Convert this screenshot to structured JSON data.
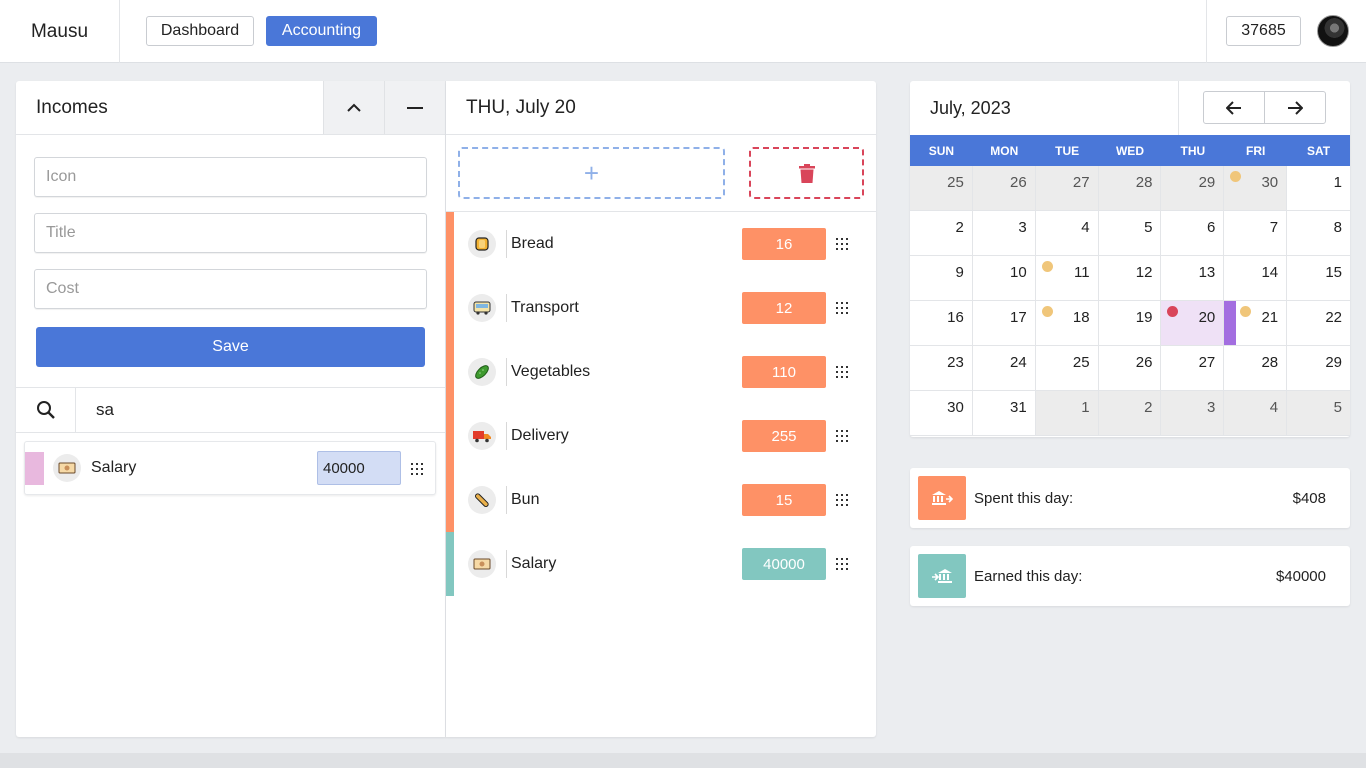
{
  "app": {
    "brand": "Mausu",
    "balance": "37685"
  },
  "nav": {
    "dashboard": "Dashboard",
    "accounting": "Accounting"
  },
  "colors": {
    "accent": "#4a77d8",
    "expense": "#fe9166",
    "income": "#82c7c0",
    "danger": "#d9455a",
    "today": "#efe1f6"
  },
  "incomes": {
    "title": "Incomes",
    "fields": {
      "icon_placeholder": "Icon",
      "title_placeholder": "Title",
      "cost_placeholder": "Cost"
    },
    "save_label": "Save",
    "search_value": "sa",
    "results": [
      {
        "icon": "money-icon",
        "label": "Salary",
        "cost": "40000"
      }
    ]
  },
  "day": {
    "title": "THU, July 20",
    "add_label": "+",
    "entries": [
      {
        "icon": "bread-icon",
        "label": "Bread",
        "value": "16",
        "kind": "expense"
      },
      {
        "icon": "bus-icon",
        "label": "Transport",
        "value": "12",
        "kind": "expense"
      },
      {
        "icon": "cucumber-icon",
        "label": "Vegetables",
        "value": "110",
        "kind": "expense"
      },
      {
        "icon": "truck-icon",
        "label": "Delivery",
        "value": "255",
        "kind": "expense"
      },
      {
        "icon": "baguette-icon",
        "label": "Bun",
        "value": "15",
        "kind": "expense"
      },
      {
        "icon": "money-icon",
        "label": "Salary",
        "value": "40000",
        "kind": "income"
      }
    ]
  },
  "calendar": {
    "title": "July, 2023",
    "weekdays": [
      "SUN",
      "MON",
      "TUE",
      "WED",
      "THU",
      "FRI",
      "SAT"
    ],
    "days": [
      {
        "n": "25",
        "other": true
      },
      {
        "n": "26",
        "other": true
      },
      {
        "n": "27",
        "other": true
      },
      {
        "n": "28",
        "other": true
      },
      {
        "n": "29",
        "other": true
      },
      {
        "n": "30",
        "other": true,
        "dot": "#f0c67a"
      },
      {
        "n": "1"
      },
      {
        "n": "2"
      },
      {
        "n": "3"
      },
      {
        "n": "4"
      },
      {
        "n": "5"
      },
      {
        "n": "6"
      },
      {
        "n": "7"
      },
      {
        "n": "8"
      },
      {
        "n": "9"
      },
      {
        "n": "10"
      },
      {
        "n": "11",
        "dot": "#f0c67a"
      },
      {
        "n": "12"
      },
      {
        "n": "13"
      },
      {
        "n": "14"
      },
      {
        "n": "15"
      },
      {
        "n": "16"
      },
      {
        "n": "17"
      },
      {
        "n": "18",
        "dot": "#f0c67a"
      },
      {
        "n": "19"
      },
      {
        "n": "20",
        "today": true,
        "dot": "#d9455a"
      },
      {
        "n": "21",
        "mark": true,
        "dot": "#f0c67a"
      },
      {
        "n": "22"
      },
      {
        "n": "23"
      },
      {
        "n": "24"
      },
      {
        "n": "25"
      },
      {
        "n": "26"
      },
      {
        "n": "27"
      },
      {
        "n": "28"
      },
      {
        "n": "29"
      },
      {
        "n": "30"
      },
      {
        "n": "31"
      },
      {
        "n": "1",
        "other": true
      },
      {
        "n": "2",
        "other": true
      },
      {
        "n": "3",
        "other": true
      },
      {
        "n": "4",
        "other": true
      },
      {
        "n": "5",
        "other": true
      }
    ]
  },
  "stats": {
    "spent": {
      "label": "Spent this day:",
      "amount": "$408"
    },
    "earned": {
      "label": "Earned this day:",
      "amount": "$40000"
    }
  }
}
